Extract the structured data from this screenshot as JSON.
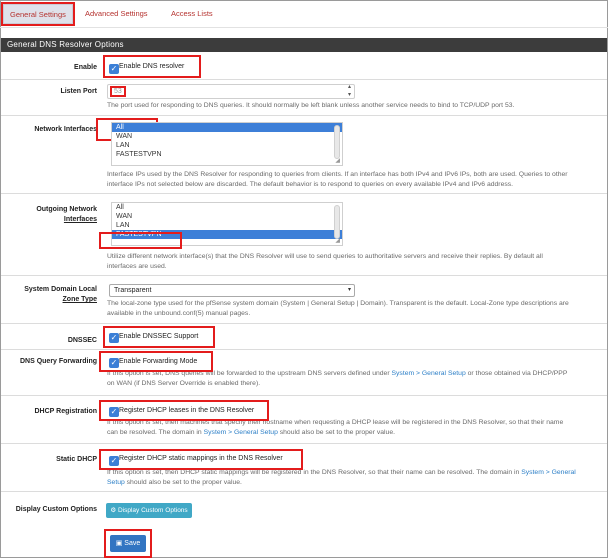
{
  "tabs": [
    "General Settings",
    "Advanced Settings",
    "Access Lists"
  ],
  "section_title": "General DNS Resolver Options",
  "enable": {
    "label": "Enable",
    "checkbox": "Enable DNS resolver"
  },
  "listen_port": {
    "label": "Listen Port",
    "placeholder": "53",
    "help": "The port used for responding to DNS queries. It should normally be left blank unless another service needs to bind to TCP/UDP port 53."
  },
  "network_interfaces": {
    "label": "Network Interfaces",
    "options": [
      "All",
      "WAN",
      "LAN",
      "FASTESTVPN"
    ],
    "selected": "All",
    "help": [
      "Interface IPs used by the DNS Resolver for responding to queries from clients. If an interface has both IPv4 and IPv6 IPs, both are used. Queries to other",
      "interface IPs not selected below are discarded. The default behavior is to respond to queries on every available IPv4 and IPv6 address."
    ]
  },
  "outgoing_interfaces": {
    "label_line1": "Outgoing Network",
    "label_line2": "Interfaces",
    "options": [
      "All",
      "WAN",
      "LAN",
      "FASTESTVPN"
    ],
    "selected": "FASTESTVPN",
    "help": [
      "Utilize different network interface(s) that the DNS Resolver will use to send queries to authoritative servers and receive their replies. By default all",
      "interfaces are used."
    ]
  },
  "zone_type": {
    "label_line1": "System Domain Local",
    "label_line2": "Zone Type",
    "value": "Transparent",
    "help": [
      "The local-zone type used for the pfSense system domain (System | General Setup | Domain). Transparent is the default. Local-Zone type descriptions are",
      "available in the unbound.conf(5) manual pages."
    ]
  },
  "dnssec": {
    "label": "DNSSEC",
    "checkbox": "Enable DNSSEC Support"
  },
  "dns_forwarding": {
    "label": "DNS Query Forwarding",
    "checkbox": "Enable Forwarding Mode",
    "help_line1_pre": "If this option is set, DNS queries will be forwarded to the upstream DNS servers defined under ",
    "help_line1_link": "System > General Setup",
    "help_line1_post": " or those obtained via DHCP/PPP",
    "help_line2": "on WAN (if DNS Server Override is enabled there)."
  },
  "dhcp_registration": {
    "label": "DHCP Registration",
    "checkbox": "Register DHCP leases in the DNS Resolver",
    "help_line1": "If this option is set, then machines that specify their hostname when requesting a DHCP lease will be registered in the DNS Resolver, so that their name",
    "help_line2_pre": "can be resolved. The domain in ",
    "help_line2_link": "System > General Setup",
    "help_line2_post": " should also be set to the proper value."
  },
  "static_dhcp": {
    "label": "Static DHCP",
    "checkbox": "Register DHCP static mappings in the DNS Resolver",
    "help_line1_pre": "If this option is set, then DHCP static mappings will be registered in the DNS Resolver, so that their name can be resolved. The domain in ",
    "help_line1_link": "System > General",
    "help_line2_link": "Setup",
    "help_line2_post": " should also be set to the proper value."
  },
  "custom_options": {
    "label": "Display Custom Options",
    "button": "Display Custom Options"
  },
  "save_button": "Save",
  "colors": {
    "accent": "#3b7fd6",
    "highlight": "#e31c1c",
    "section_bar": "#3c3c3c",
    "info_button": "#40a8c6"
  }
}
